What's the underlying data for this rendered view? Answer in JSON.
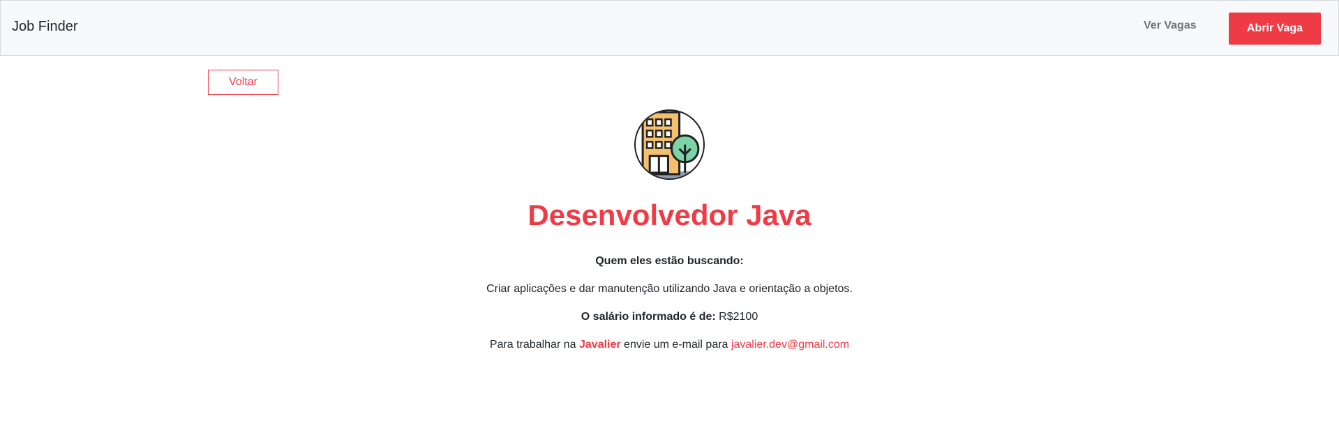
{
  "navbar": {
    "brand": "Job Finder",
    "link_label": "Ver Vagas",
    "cta_label": "Abrir Vaga"
  },
  "back_button": {
    "label": "Voltar"
  },
  "company_logo": {
    "icon": "building-with-tree-icon"
  },
  "job": {
    "title": "Desenvolvedor Java",
    "looking_for_label": "Quem eles estão buscando:",
    "description": "Criar aplicações e dar manutenção utilizando Java e orientação a objetos.",
    "salary_label": "O salário informado é de:",
    "salary_value": "R$2100",
    "contact_prefix": "Para trabalhar na",
    "company": "Javalier",
    "contact_middle": "envie um e-mail para",
    "email": "javalier.dev@gmail.com"
  },
  "colors": {
    "accent": "#ef3b45",
    "navbar_bg": "#f8f9fa",
    "muted": "#6c757d"
  }
}
